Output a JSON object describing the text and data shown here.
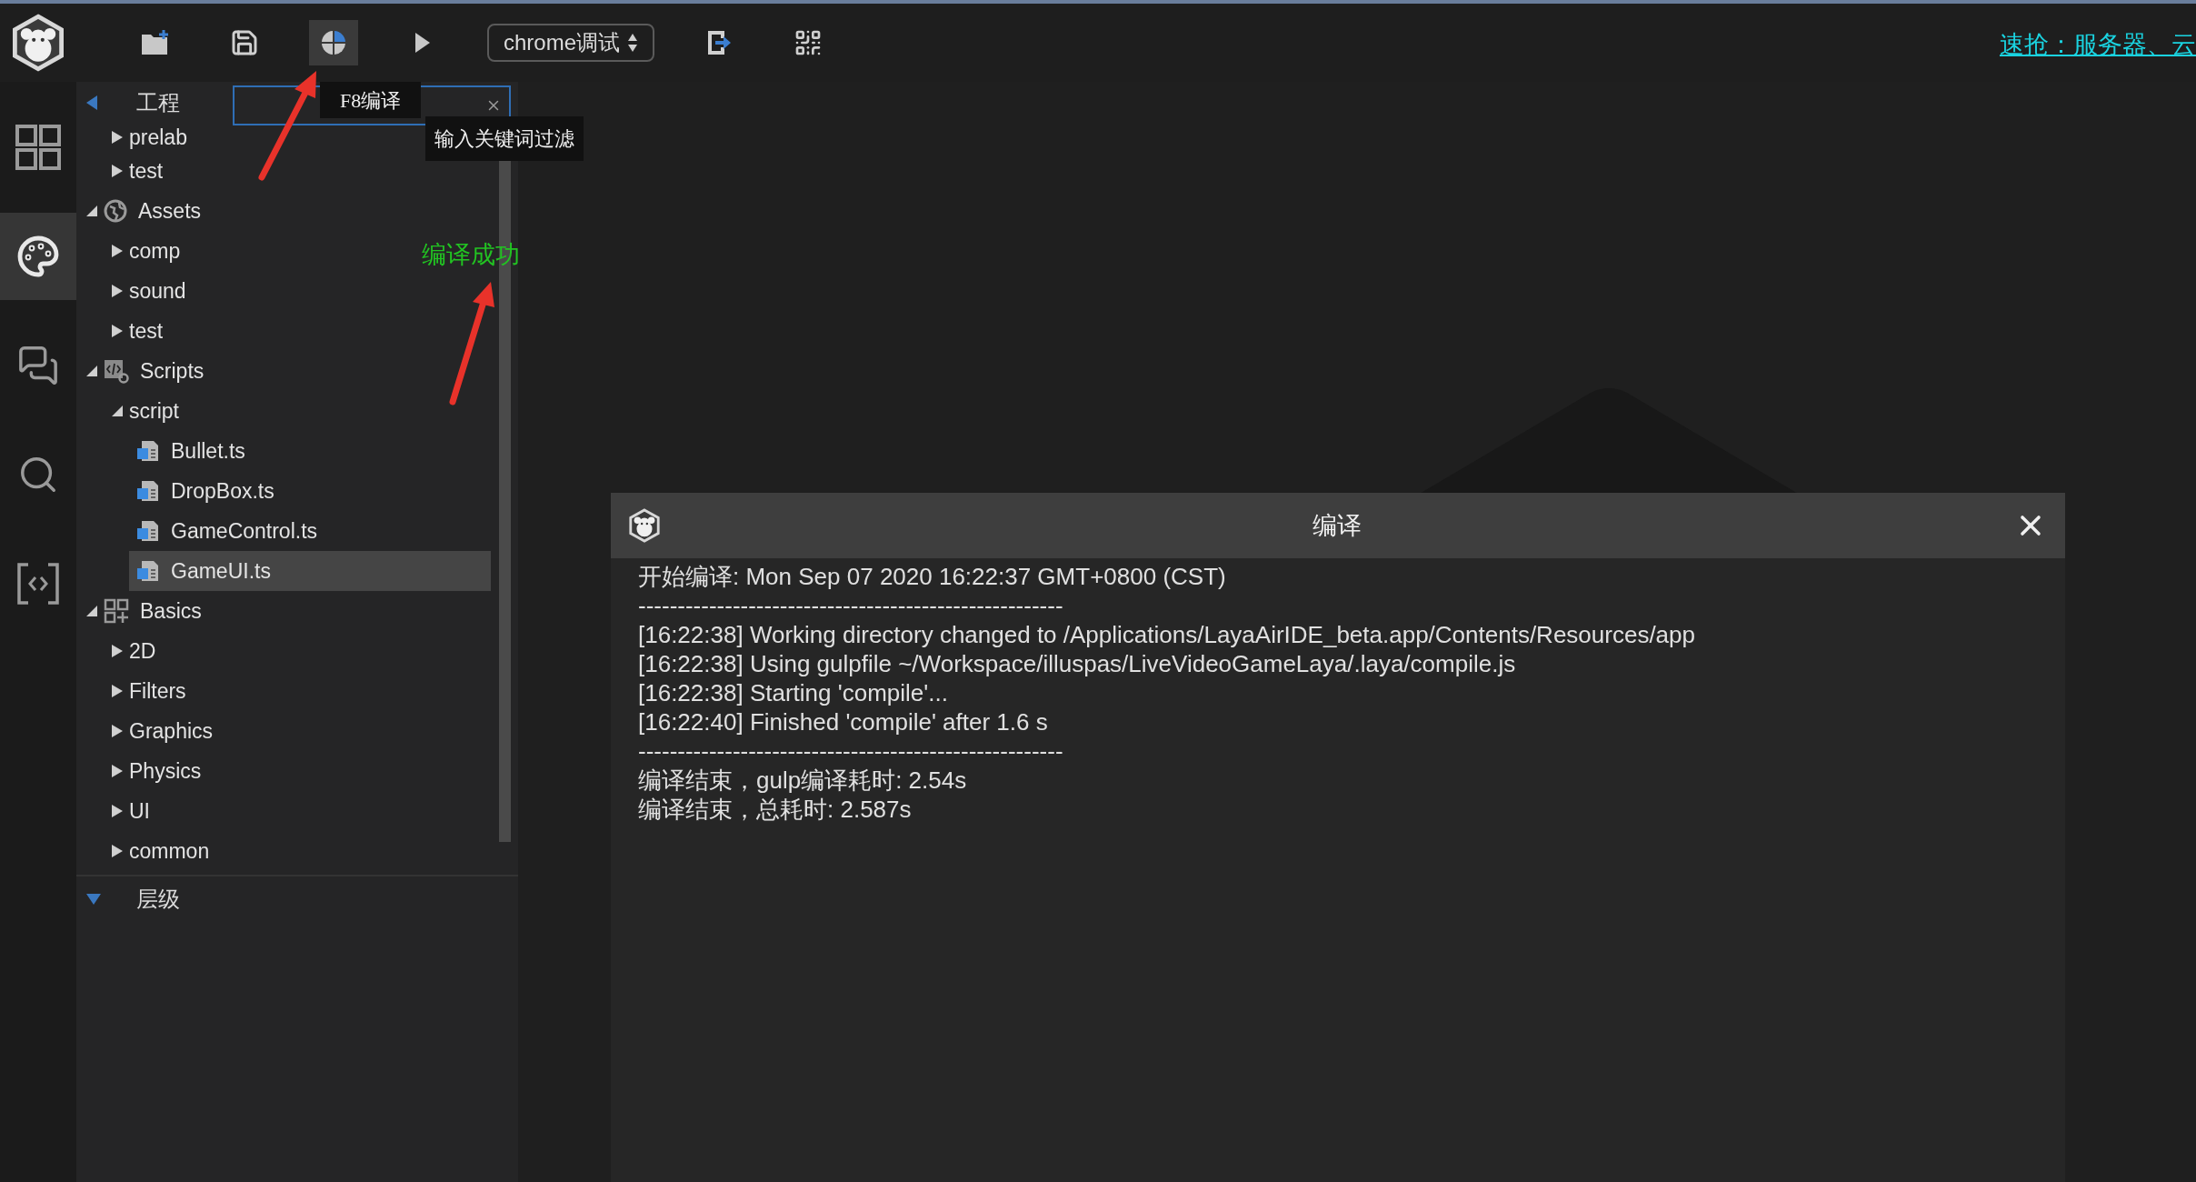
{
  "toolbar": [
    {
      "kind": "new-folder",
      "highlighted": false
    },
    {
      "kind": "save",
      "highlighted": false
    },
    {
      "kind": "compile",
      "highlighted": true
    },
    {
      "kind": "play",
      "highlighted": false
    },
    {
      "kind": "dropdown",
      "value": "chrome调试",
      "highlighted": false
    },
    {
      "kind": "export",
      "highlighted": false
    },
    {
      "kind": "qr-code",
      "highlighted": false
    }
  ],
  "promo_link": "速抢：服务器、云",
  "tooltips": [
    "F8编译",
    "输入关键词过滤"
  ],
  "activity_bar": [
    {
      "kind": "grid",
      "selected": false
    },
    {
      "kind": "palette",
      "selected": true
    },
    {
      "kind": "chat",
      "selected": false
    },
    {
      "kind": "search",
      "selected": false
    },
    {
      "kind": "code",
      "selected": false
    }
  ],
  "project_panel": {
    "title": "工程",
    "tree_partial": [
      {
        "label": "prelab",
        "kind": "folder",
        "expanded": false,
        "selected": false
      },
      {
        "label": "test",
        "kind": "folder",
        "expanded": false,
        "selected": false
      }
    ],
    "tree": [
      {
        "label": "Assets",
        "kind": "globe-category",
        "expanded": true,
        "selected": false,
        "children": [
          {
            "label": "comp",
            "kind": "folder",
            "expanded": false,
            "selected": false
          },
          {
            "label": "sound",
            "kind": "folder",
            "expanded": false,
            "selected": false
          },
          {
            "label": "test",
            "kind": "folder",
            "expanded": false,
            "selected": false
          }
        ]
      },
      {
        "label": "Scripts",
        "kind": "code-category",
        "expanded": true,
        "selected": false,
        "children": [
          {
            "label": "script",
            "kind": "folder",
            "expanded": true,
            "selected": false,
            "children": [
              {
                "label": "Bullet.ts",
                "kind": "file",
                "selected": false
              },
              {
                "label": "DropBox.ts",
                "kind": "file",
                "selected": false
              },
              {
                "label": "GameControl.ts",
                "kind": "file",
                "selected": false
              },
              {
                "label": "GameUI.ts",
                "kind": "file",
                "selected": true
              }
            ]
          }
        ]
      },
      {
        "label": "Basics",
        "kind": "widget-category",
        "expanded": true,
        "selected": false,
        "children": [
          {
            "label": "2D",
            "kind": "folder",
            "expanded": false,
            "selected": false
          },
          {
            "label": "Filters",
            "kind": "folder",
            "expanded": false,
            "selected": false
          },
          {
            "label": "Graphics",
            "kind": "folder",
            "expanded": false,
            "selected": false
          },
          {
            "label": "Physics",
            "kind": "folder",
            "expanded": false,
            "selected": false
          },
          {
            "label": "UI",
            "kind": "folder",
            "expanded": false,
            "selected": false
          },
          {
            "label": "common",
            "kind": "folder",
            "expanded": false,
            "selected": false
          }
        ]
      }
    ]
  },
  "hierarchy_panel": {
    "title": "层级"
  },
  "annotation": "编译成功",
  "dialog": {
    "title": "编译",
    "lines": [
      "开始编译: Mon Sep 07 2020 16:22:37 GMT+0800 (CST)",
      "------------------------------------------------------",
      "[16:22:38] Working directory changed to /Applications/LayaAirIDE_beta.app/Contents/Resources/app",
      "[16:22:38] Using gulpfile ~/Workspace/illuspas/LiveVideoGameLaya/.laya/compile.js",
      "[16:22:38] Starting 'compile'...",
      "[16:22:40] Finished 'compile' after 1.6 s",
      "------------------------------------------------------",
      "编译结束，gulp编译耗时: 2.54s",
      "编译结束，总耗时: 2.587s"
    ]
  }
}
